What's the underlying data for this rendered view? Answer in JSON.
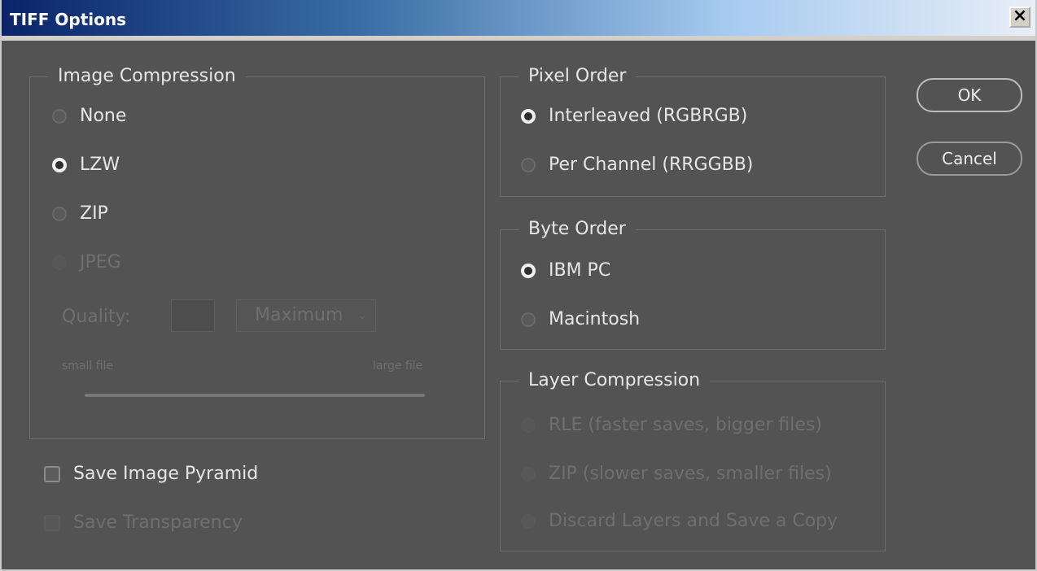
{
  "window": {
    "title": "TIFF Options",
    "close_icon": "×"
  },
  "image_compression": {
    "legend": "Image Compression",
    "options": [
      "None",
      "LZW",
      "ZIP",
      "JPEG"
    ],
    "selected": "LZW",
    "quality_label": "Quality:",
    "quality_value": "",
    "quality_select": "Maximum",
    "small_file": "small file",
    "large_file": "large file"
  },
  "pixel_order": {
    "legend": "Pixel Order",
    "options": [
      "Interleaved (RGBRGB)",
      "Per Channel (RRGGBB)"
    ],
    "selected": "Interleaved (RGBRGB)"
  },
  "byte_order": {
    "legend": "Byte Order",
    "options": [
      "IBM PC",
      "Macintosh"
    ],
    "selected": "IBM PC"
  },
  "layer_compression": {
    "legend": "Layer Compression",
    "options": [
      "RLE (faster saves, bigger files)",
      "ZIP (slower saves, smaller files)",
      "Discard Layers and Save a Copy"
    ]
  },
  "checkboxes": {
    "save_image_pyramid": "Save Image Pyramid",
    "save_transparency": "Save Transparency"
  },
  "buttons": {
    "ok": "OK",
    "cancel": "Cancel"
  }
}
